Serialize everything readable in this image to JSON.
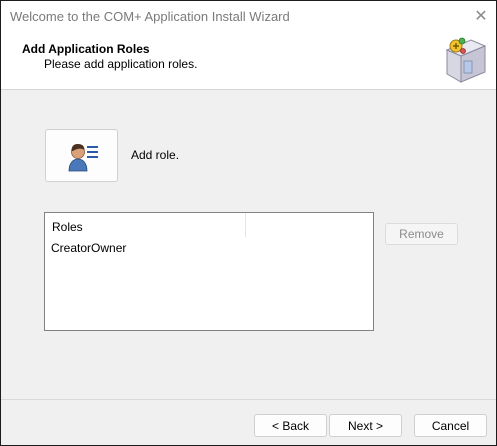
{
  "window": {
    "title": "Welcome to the COM+ Application Install Wizard",
    "close_glyph": "✕"
  },
  "header": {
    "title": "Add Application Roles",
    "subtitle": "Please add application roles.",
    "icon": "install-box-icon"
  },
  "add_role": {
    "label": "Add role.",
    "icon": "user-list-icon"
  },
  "roles_list": {
    "column_header": "Roles",
    "items": [
      "CreatorOwner"
    ]
  },
  "remove_button": {
    "label": "Remove",
    "state": "disabled"
  },
  "footer": {
    "back_label": "< Back",
    "next_label": "Next >",
    "cancel_label": "Cancel"
  }
}
